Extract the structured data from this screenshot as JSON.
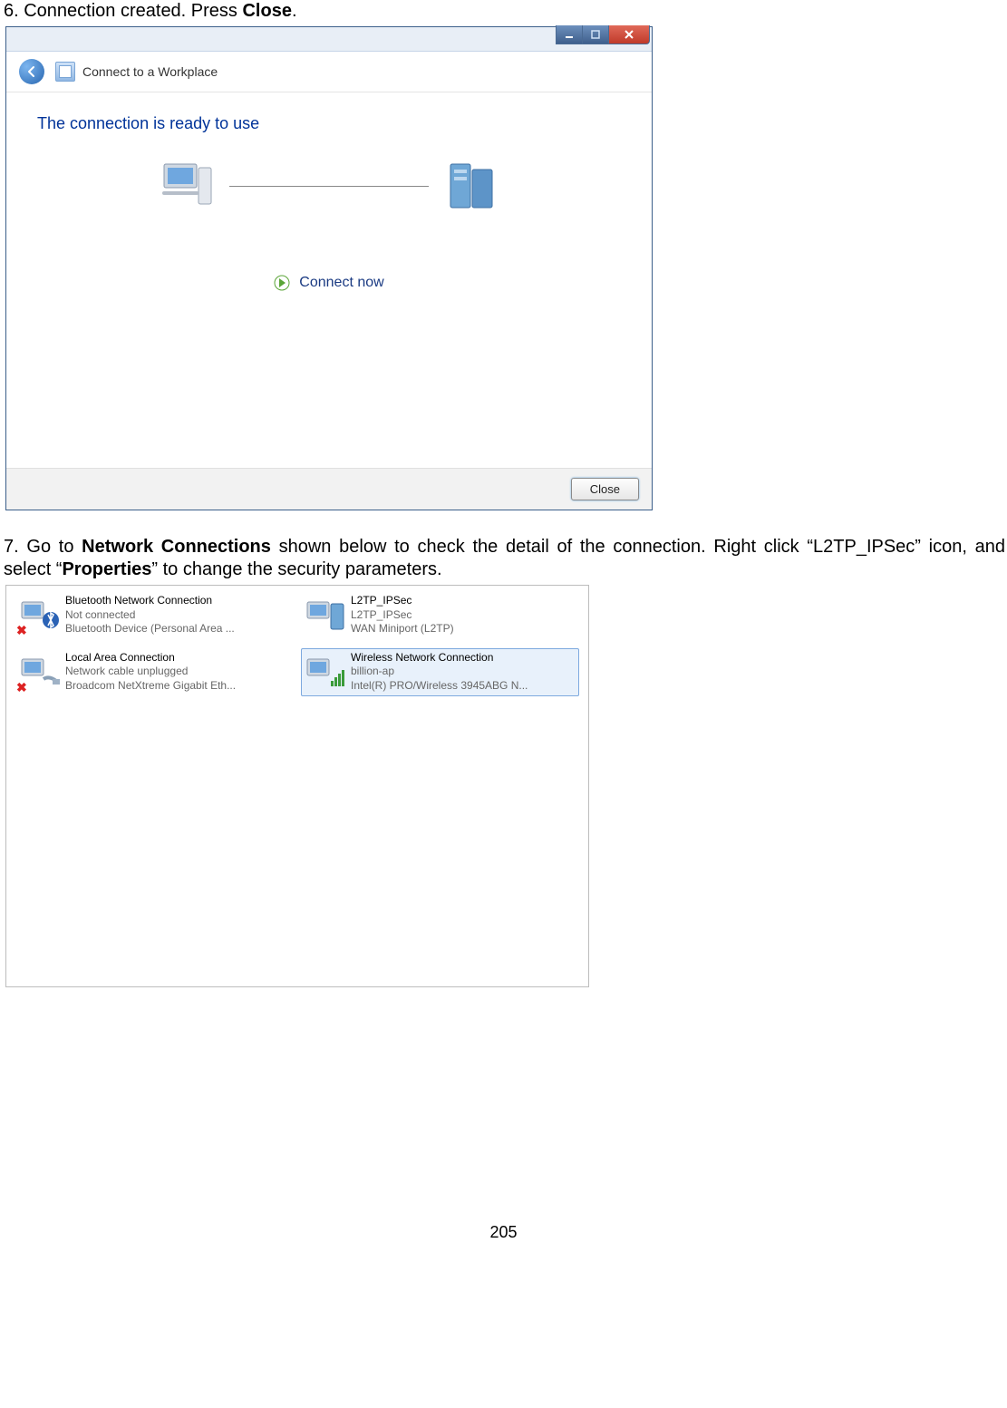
{
  "step6": {
    "text_before": "6. Connection created. Press ",
    "bold": "Close",
    "text_after": "."
  },
  "wizard": {
    "header_label": "Connect to a Workplace",
    "ready_label": "The connection is ready to use",
    "connect_now_label": "Connect now",
    "close_button_label": "Close"
  },
  "step7": {
    "text_1": "7. Go to ",
    "bold_1": "Network Connections",
    "text_2": " shown below to check the detail of the connection. Right click “L2TP_IPSec” icon, and select “",
    "bold_2": "Properties",
    "text_3": "” to change the security parameters."
  },
  "connections": [
    {
      "title": "Bluetooth Network Connection",
      "line2": "Not connected",
      "line3": "Bluetooth Device (Personal Area ...",
      "icon": "bluetooth",
      "error": true,
      "selected": false
    },
    {
      "title": "L2TP_IPSec",
      "line2": "L2TP_IPSec",
      "line3": "WAN Miniport (L2TP)",
      "icon": "vpn",
      "error": false,
      "selected": false
    },
    {
      "title": "Local Area Connection",
      "line2": "Network cable unplugged",
      "line3": "Broadcom NetXtreme Gigabit Eth...",
      "icon": "lan",
      "error": true,
      "selected": false
    },
    {
      "title": "Wireless Network Connection",
      "line2": "billion-ap",
      "line3": "Intel(R) PRO/Wireless 3945ABG N...",
      "icon": "wifi",
      "error": false,
      "selected": true
    }
  ],
  "page_number": "205"
}
